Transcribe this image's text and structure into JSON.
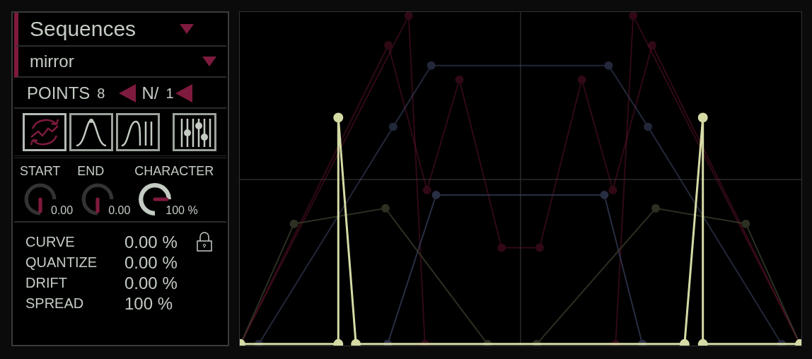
{
  "sequence_menu": {
    "label": "Sequences"
  },
  "preset_menu": {
    "label": "mirror"
  },
  "points": {
    "label": "POINTS",
    "value": "8"
  },
  "divisor": {
    "label": "N/",
    "value": "1"
  },
  "modes": [
    {
      "kind": "random",
      "selected": true
    },
    {
      "kind": "bell",
      "selected": false
    },
    {
      "kind": "ramp",
      "selected": false
    },
    {
      "kind": "sliders",
      "selected": false
    }
  ],
  "knobs": [
    {
      "label": "START",
      "reading": "0.00"
    },
    {
      "label": "END",
      "reading": "0.00"
    },
    {
      "label": "CHARACTER",
      "reading": "100 %"
    }
  ],
  "params": [
    {
      "label": "CURVE",
      "value": "0.00 %"
    },
    {
      "label": "QUANTIZE",
      "value": "0.00 %"
    },
    {
      "label": "DRIFT",
      "value": "0.00 %"
    },
    {
      "label": "SPREAD",
      "value": "100 %"
    }
  ]
}
